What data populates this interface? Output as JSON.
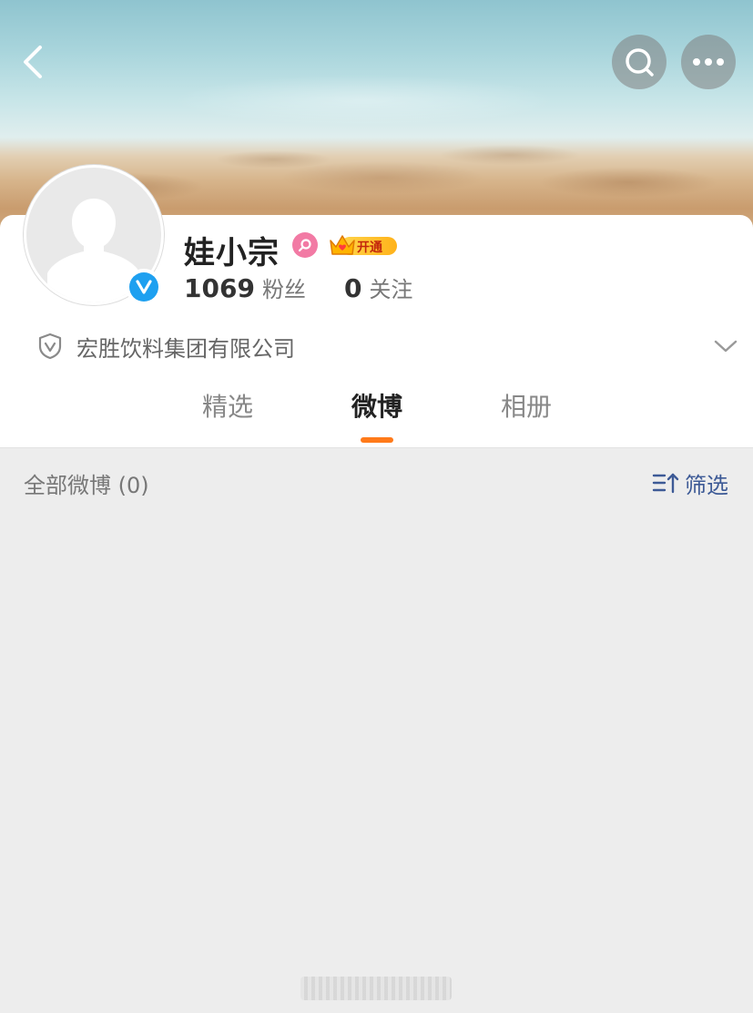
{
  "profile": {
    "name": "娃小宗",
    "vip_label": "开通",
    "followers_count": "1069",
    "followers_label": "粉丝",
    "following_count": "0",
    "following_label": "关注",
    "company": "宏胜饮料集团有限公司"
  },
  "tabs": [
    {
      "label": "精选",
      "active": false
    },
    {
      "label": "微博",
      "active": true
    },
    {
      "label": "相册",
      "active": false
    }
  ],
  "feed": {
    "title": "全部微博 (0)",
    "filter_label": "筛选"
  },
  "colors": {
    "accent": "#ff7a1a",
    "link": "#3d5a96",
    "verified": "#1ea0f0",
    "gender": "#f27aa4"
  },
  "icons": {
    "back": "back-icon",
    "search": "search-icon",
    "more": "more-icon",
    "verified": "verified-icon",
    "gender": "female-icon",
    "vip": "crown-icon",
    "company": "shield-check-icon",
    "expand": "chevron-down-icon",
    "filter": "sort-filter-icon"
  }
}
